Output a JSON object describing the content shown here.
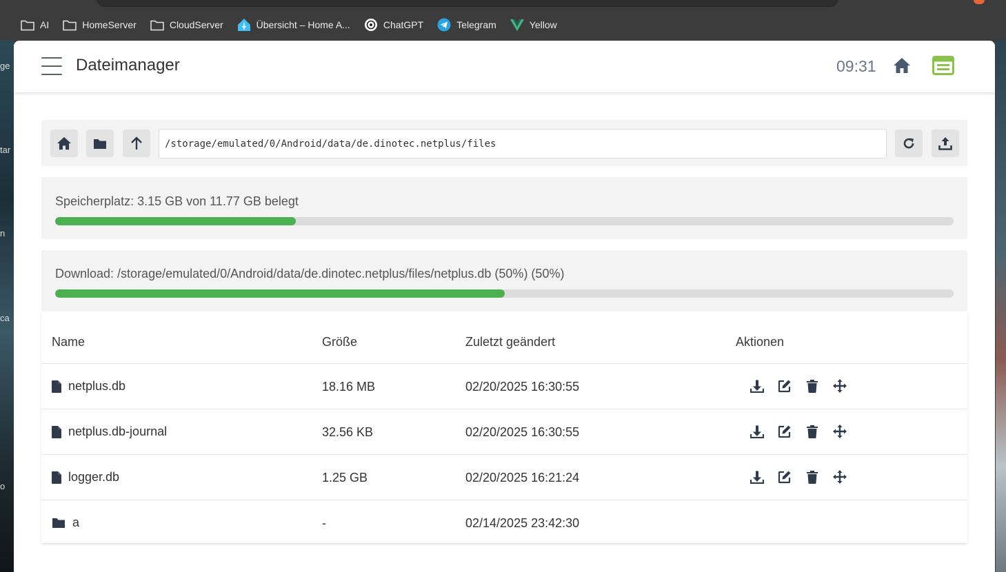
{
  "bookmarks": [
    {
      "label": "AI",
      "icon": "folder-icon"
    },
    {
      "label": "HomeServer",
      "icon": "folder-icon"
    },
    {
      "label": "CloudServer",
      "icon": "folder-icon"
    },
    {
      "label": "Übersicht – Home A...",
      "icon": "home-assistant-icon"
    },
    {
      "label": "ChatGPT",
      "icon": "chatgpt-icon"
    },
    {
      "label": "Telegram",
      "icon": "telegram-icon"
    },
    {
      "label": "Yellow",
      "icon": "vue-logo-icon"
    }
  ],
  "desktop_fragments": [
    "ge",
    "tar",
    "n",
    "ca",
    "o"
  ],
  "app": {
    "title": "Dateimanager",
    "clock": "09:31"
  },
  "toolbar": {
    "path": "/storage/emulated/0/Android/data/de.dinotec.netplus/files"
  },
  "storage": {
    "label": "Speicherplatz: 3.15 GB von 11.77 GB belegt",
    "used_fraction": 0.268
  },
  "download": {
    "label": "Download: /storage/emulated/0/Android/data/de.dinotec.netplus/files/netplus.db (50%) (50%)",
    "progress_fraction": 0.5
  },
  "table": {
    "headers": {
      "name": "Name",
      "size": "Größe",
      "modified": "Zuletzt geändert",
      "actions": "Aktionen"
    },
    "rows": [
      {
        "type": "file",
        "name": "netplus.db",
        "size": "18.16 MB",
        "modified": "02/20/2025 16:30:55"
      },
      {
        "type": "file",
        "name": "netplus.db-journal",
        "size": "32.56 KB",
        "modified": "02/20/2025 16:30:55"
      },
      {
        "type": "file",
        "name": "logger.db",
        "size": "1.25 GB",
        "modified": "02/20/2025 16:21:24"
      },
      {
        "type": "folder",
        "name": "a",
        "size": "-",
        "modified": "02/14/2025 23:42:30"
      }
    ]
  },
  "colors": {
    "accent": "#4caf50",
    "icon_slate": "#4a5a6e",
    "db_icon_green": "#8bc34a"
  }
}
